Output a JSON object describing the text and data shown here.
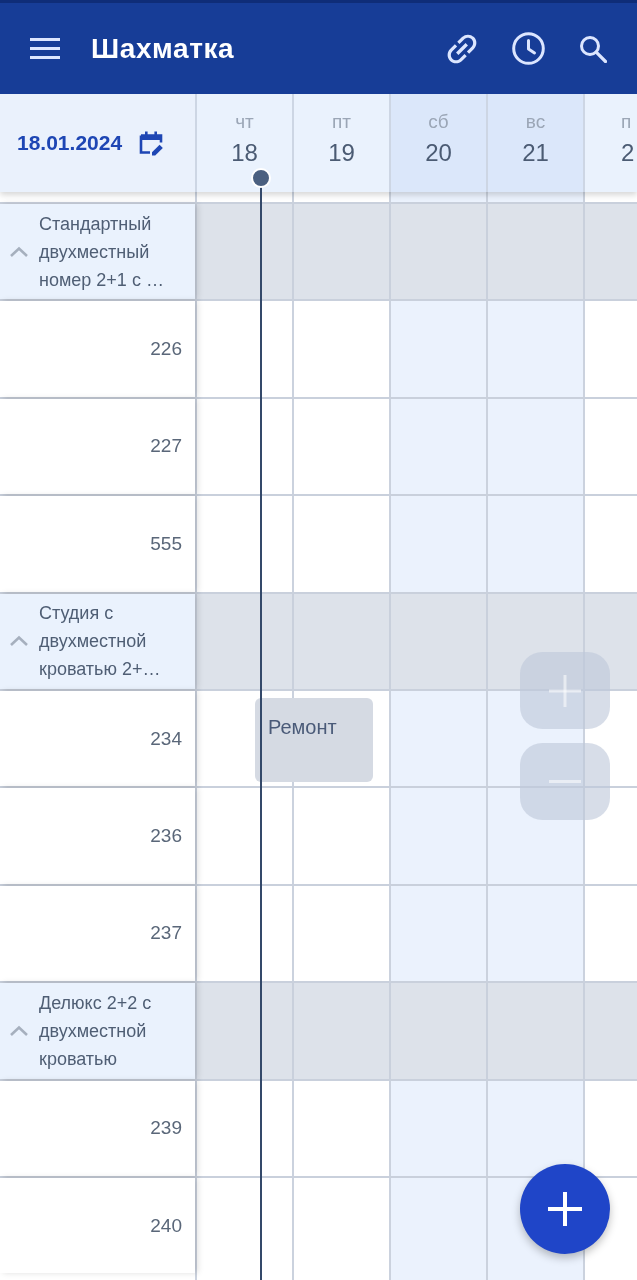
{
  "app_bar": {
    "title": "Шахматка"
  },
  "date_picker": {
    "value": "18.01.2024"
  },
  "days": [
    {
      "weekday": "чт",
      "day": "18",
      "weekend": false
    },
    {
      "weekday": "пт",
      "day": "19",
      "weekend": false
    },
    {
      "weekday": "сб",
      "day": "20",
      "weekend": true
    },
    {
      "weekday": "вс",
      "day": "21",
      "weekend": true
    },
    {
      "weekday": "п",
      "day": "2",
      "weekend": false
    }
  ],
  "room_types": [
    {
      "name": "Стандартный двухместный номер 2+1 с …",
      "expanded": true,
      "rooms": [
        {
          "number": "226"
        },
        {
          "number": "227"
        },
        {
          "number": "555"
        }
      ]
    },
    {
      "name": "Студия с двухместной кроватью 2+…",
      "expanded": true,
      "rooms": [
        {
          "number": "234",
          "blocks": [
            {
              "label": "Ремонт"
            }
          ]
        },
        {
          "number": "236"
        },
        {
          "number": "237"
        }
      ]
    },
    {
      "name": "Делюкс 2+2 с двухместной кроватью",
      "expanded": true,
      "rooms": [
        {
          "number": "239"
        },
        {
          "number": "240"
        }
      ]
    }
  ]
}
